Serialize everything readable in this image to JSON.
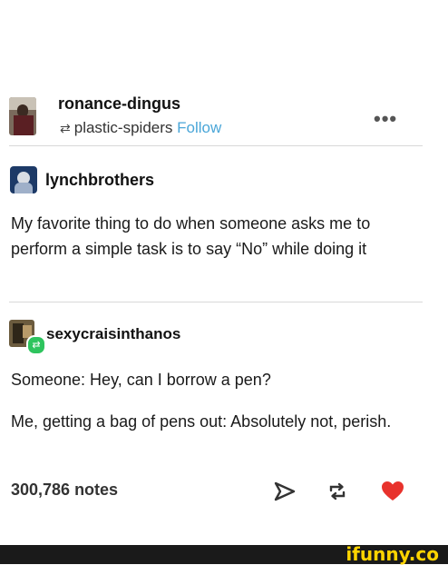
{
  "post": {
    "author": "ronance-dingus",
    "reblogged_from": "plastic-spiders",
    "follow_label": "Follow",
    "menu_label": "•••",
    "reblog_symbol": "⇄",
    "trail": [
      {
        "username": "lynchbrothers",
        "text": "My favorite thing to do when someone asks me to perform a simple task is to say “No” while doing it"
      },
      {
        "username": "sexycraisinthanos",
        "paragraphs": [
          "Someone: Hey, can I borrow a pen?",
          "Me, getting a bag of pens out: Absolutely not, perish."
        ]
      }
    ],
    "notes": "300,786 notes"
  },
  "footer": {
    "watermark": "ifunny.co"
  },
  "colors": {
    "follow": "#4aa6d8",
    "heart": "#e8322c",
    "reblog_badge": "#2ec45e",
    "watermark": "#ffd400"
  }
}
